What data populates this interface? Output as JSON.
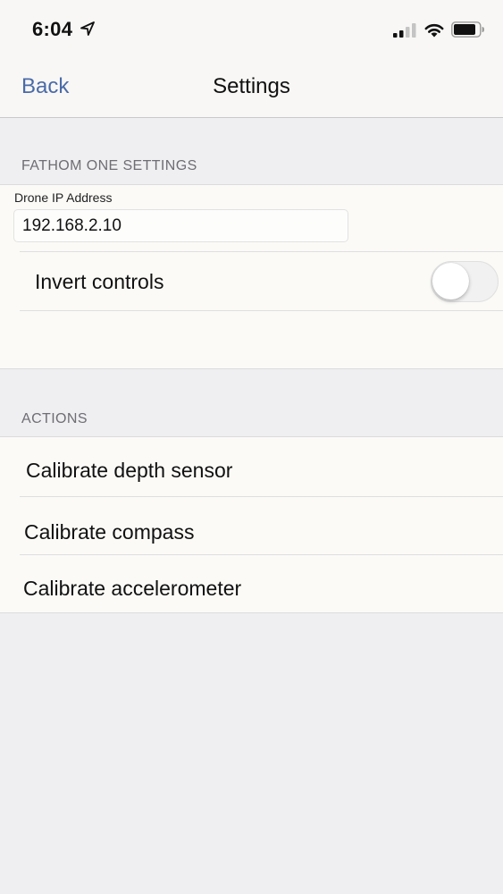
{
  "status_bar": {
    "time": "6:04",
    "icons": [
      "location-arrow-icon",
      "cellular-signal-icon",
      "wifi-icon",
      "battery-icon"
    ]
  },
  "nav": {
    "back_label": "Back",
    "title": "Settings"
  },
  "settings_section": {
    "header": "FATHOM ONE SETTINGS",
    "ip_label": "Drone IP Address",
    "ip_value": "192.168.2.10",
    "invert_label": "Invert controls",
    "invert_on": false
  },
  "actions_section": {
    "header": "ACTIONS",
    "items": [
      {
        "label": "Calibrate depth sensor"
      },
      {
        "label": "Calibrate compass"
      },
      {
        "label": "Calibrate accelerometer"
      }
    ]
  },
  "colors": {
    "accent": "#4a6ba8",
    "background": "#efeff2",
    "cell": "#fbfaf7"
  }
}
